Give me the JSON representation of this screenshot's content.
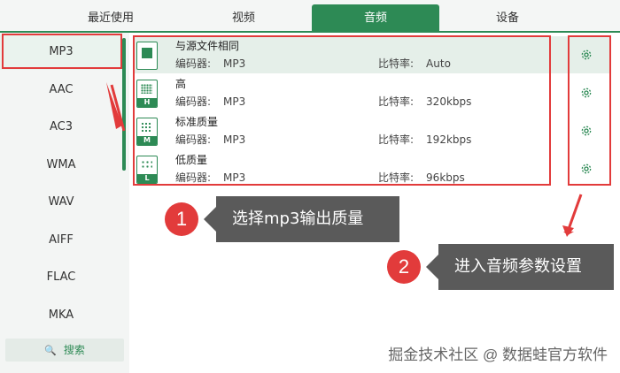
{
  "tabs": [
    {
      "label": "最近使用",
      "active": false
    },
    {
      "label": "视频",
      "active": false
    },
    {
      "label": "音频",
      "active": true
    },
    {
      "label": "设备",
      "active": false
    }
  ],
  "formats": [
    "MP3",
    "AAC",
    "AC3",
    "WMA",
    "WAV",
    "AIFF",
    "FLAC",
    "MKA"
  ],
  "selected_format": "MP3",
  "search_label": "搜索",
  "qualities": [
    {
      "name": "与源文件相同",
      "encoder_label": "编码器:",
      "encoder": "MP3",
      "bitrate_label": "比特率:",
      "bitrate": "Auto",
      "icon": "source-file-icon",
      "badge": ""
    },
    {
      "name": "高",
      "encoder_label": "编码器:",
      "encoder": "MP3",
      "bitrate_label": "比特率:",
      "bitrate": "320kbps",
      "icon": "quality-high-icon",
      "badge": "H"
    },
    {
      "name": "标准质量",
      "encoder_label": "编码器:",
      "encoder": "MP3",
      "bitrate_label": "比特率:",
      "bitrate": "192kbps",
      "icon": "quality-medium-icon",
      "badge": "M"
    },
    {
      "name": "低质量",
      "encoder_label": "编码器:",
      "encoder": "MP3",
      "bitrate_label": "比特率:",
      "bitrate": "96kbps",
      "icon": "quality-low-icon",
      "badge": "L"
    }
  ],
  "annotations": [
    {
      "number": "1",
      "text": "选择mp3输出质量"
    },
    {
      "number": "2",
      "text": "进入音频参数设置"
    }
  ],
  "watermark": "掘金技术社区 @ 数据蛙官方软件",
  "colors": {
    "accent": "#2d8a55",
    "highlight": "#e23b3b",
    "callout_bg": "#5a5a5a"
  }
}
